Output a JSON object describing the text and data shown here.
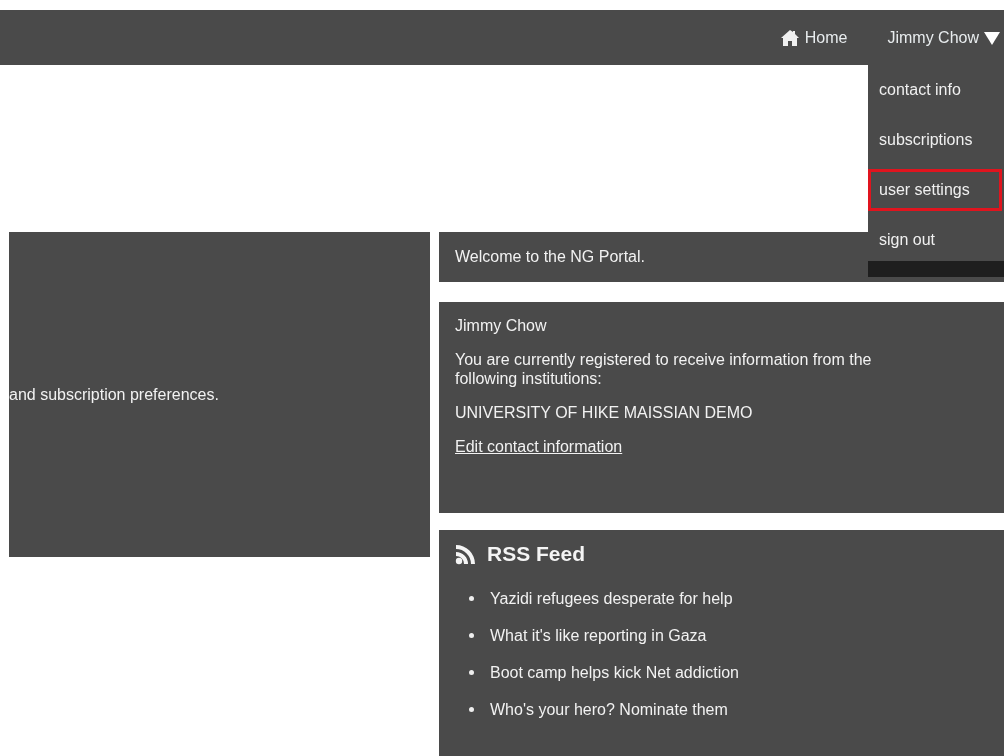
{
  "nav": {
    "home": "Home",
    "user": "Jimmy Chow"
  },
  "user_menu": {
    "expanded": true,
    "items": [
      {
        "label": "contact info",
        "selected": false
      },
      {
        "label": "subscriptions",
        "selected": false
      },
      {
        "label": "user settings",
        "selected": true
      },
      {
        "label": "sign out",
        "selected": false
      }
    ]
  },
  "intro_panel": {
    "text": "and subscription preferences."
  },
  "welcome": {
    "text": "Welcome to the NG Portal."
  },
  "account": {
    "name": "Jimmy Chow",
    "message": "You are currently registered to receive information from the following institutions:",
    "institution": "UNIVERSITY OF HIKE MAISSIAN DEMO",
    "link": "Edit contact information"
  },
  "rss": {
    "title": "RSS Feed",
    "items": [
      "Yazidi refugees desperate for help",
      "What it's like reporting in Gaza",
      "Boot camp helps kick Net addiction",
      "Who's your hero? Nominate them"
    ]
  }
}
